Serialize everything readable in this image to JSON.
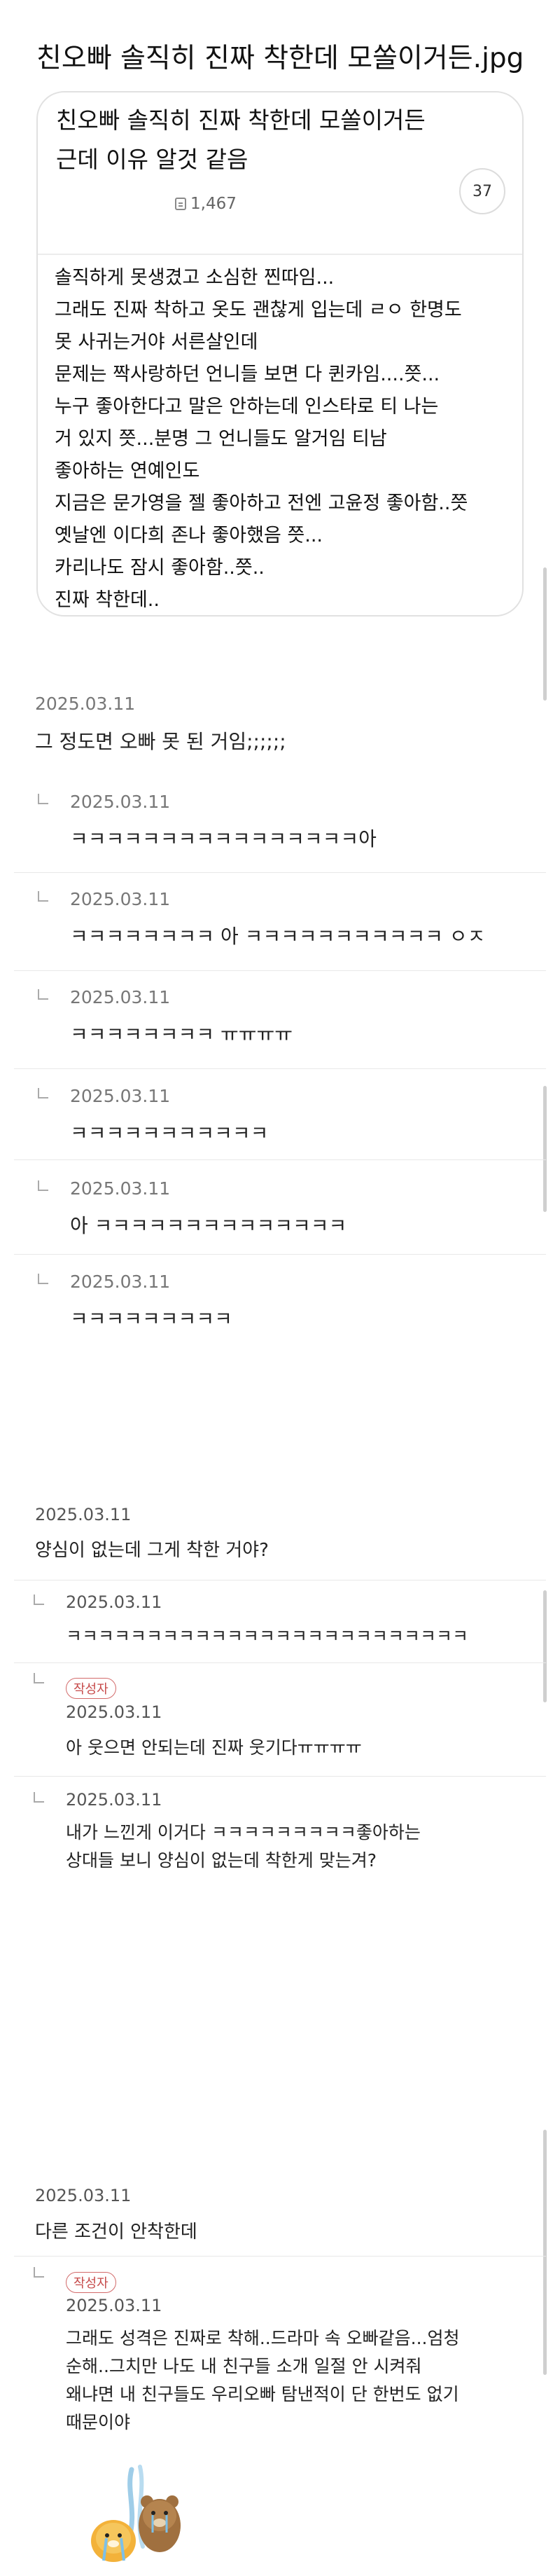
{
  "page_title": "친오빠 솔직히 진짜 착한데 모쏠이거든.jpg",
  "post": {
    "title_lines": [
      "친오빠 솔직히 진짜 착한데 모쏠이거든",
      "근데 이유 알것 같음"
    ],
    "views": "1,467",
    "comment_count": "37",
    "body_lines": [
      "솔직하게 못생겼고 소심한 찐따임...",
      "그래도 진짜 착하고 옷도 괜찮게 입는데 ㄹㅇ 한명도",
      "못 사귀는거야 서른살인데",
      "문제는 짝사랑하던 언니들 보면 다 퀸카임....쯧...",
      "누구 좋아한다고 말은 안하는데 인스타로 티 나는",
      "거 있지 쯧...분명 그 언니들도 알거임 티남",
      "좋아하는 연예인도",
      "지금은 문가영을 젤 좋아하고 전엔 고윤정 좋아함..쯧",
      "옛날엔 이다희 존나 좋아했음 쯧...",
      "카리나도 잠시 좋아함..쯧..",
      "진짜 착한데.."
    ]
  },
  "comments": [
    {
      "date": "2025.03.11",
      "text": "그 정도면 오빠 못 된 거임;;;;;;",
      "replies": [
        {
          "date": "2025.03.11",
          "text": "ㅋㅋㅋㅋㅋㅋㅋㅋㅋㅋㅋㅋㅋㅋㅋㅋ아"
        },
        {
          "date": "2025.03.11",
          "text": "ㅋㅋㅋㅋㅋㅋㅋㅋ 아  ㅋㅋㅋㅋㅋㅋㅋㅋㅋㅋㅋ ㅇㅈ"
        },
        {
          "date": "2025.03.11",
          "text": "ㅋㅋㅋㅋㅋㅋㅋㅋ ㅠㅠㅠㅠ"
        },
        {
          "date": "2025.03.11",
          "text": "ㅋㅋㅋㅋㅋㅋㅋㅋㅋㅋㅋ"
        },
        {
          "date": "2025.03.11",
          "text": "아 ㅋㅋㅋㅋㅋㅋㅋㅋㅋㅋㅋㅋㅋㅋ"
        },
        {
          "date": "2025.03.11",
          "text": "ㅋㅋㅋㅋㅋㅋㅋㅋㅋ"
        }
      ]
    },
    {
      "date": "2025.03.11",
      "text": "양심이 없는데 그게 착한 거야?",
      "replies": [
        {
          "date": "2025.03.11",
          "text": "ㅋㅋㅋㅋㅋㅋㅋㅋㅋㅋㅋㅋㅋㅋㅋㅋㅋㅋㅋㅋㅋㅋㅋㅋㅋ"
        },
        {
          "badge": "작성자",
          "date": "2025.03.11",
          "text": "아  웃으면 안되는데 진짜 웃기다ㅠㅠㅠㅠ"
        },
        {
          "date": "2025.03.11",
          "lines": [
            "내가 느낀게 이거다 ㅋㅋㅋㅋㅋㅋㅋㅋㅋ좋아하는",
            "상대들 보니 양심이 없는데 착한게 맞는겨?"
          ]
        }
      ]
    },
    {
      "date": "2025.03.11",
      "text": "다른 조건이 안착한데",
      "replies": [
        {
          "badge": "작성자",
          "date": "2025.03.11",
          "lines": [
            "그래도 성격은 진짜로 착해..드라마 속 오빠같음...엄청",
            "순해..그치만 나도 내 친구들 소개 일절 안 시켜줘",
            "왜냐면 내 친구들도 우리오빠 탐낸적이 단 한번도 없기",
            "때문이야"
          ]
        }
      ]
    }
  ],
  "colors": {
    "badge_red": "#c64a4a",
    "divider": "#e8e8e8"
  }
}
